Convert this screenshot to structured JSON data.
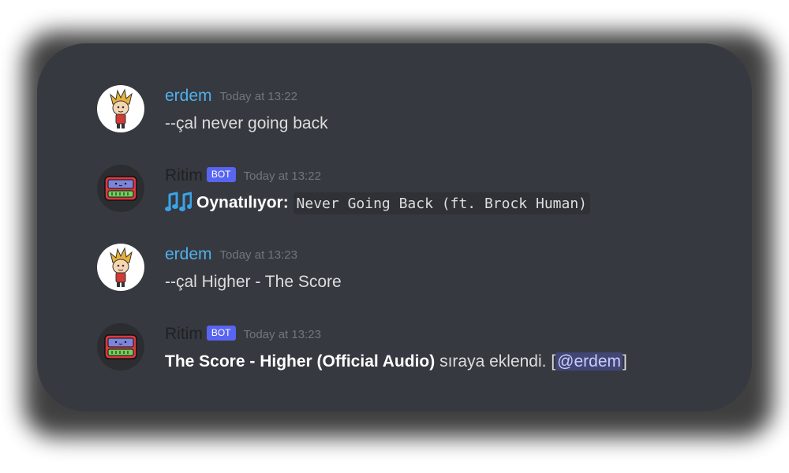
{
  "messages": [
    {
      "author": "erdem",
      "time": "Today at 13:22",
      "text": "--çal never going back"
    },
    {
      "author": "Ritim",
      "badge": "BOT",
      "time": "Today at 13:22",
      "label": "Oynatılıyor:",
      "code": "Never Going Back (ft. Brock Human)",
      "icon": "music-notes-icon"
    },
    {
      "author": "erdem",
      "time": "Today at 13:23",
      "text": "--çal Higher - The Score"
    },
    {
      "author": "Ritim",
      "badge": "BOT",
      "time": "Today at 13:23",
      "bold": "The Score - Higher (Official Audio)",
      "rest": " sıraya eklendi. [",
      "mention": "@erdem",
      "end": "]"
    }
  ],
  "colors": {
    "background": "#36393f",
    "username": "#4fb0ec",
    "badge": "#5865f2",
    "timestamp": "#72767d",
    "text": "#dcddde"
  }
}
